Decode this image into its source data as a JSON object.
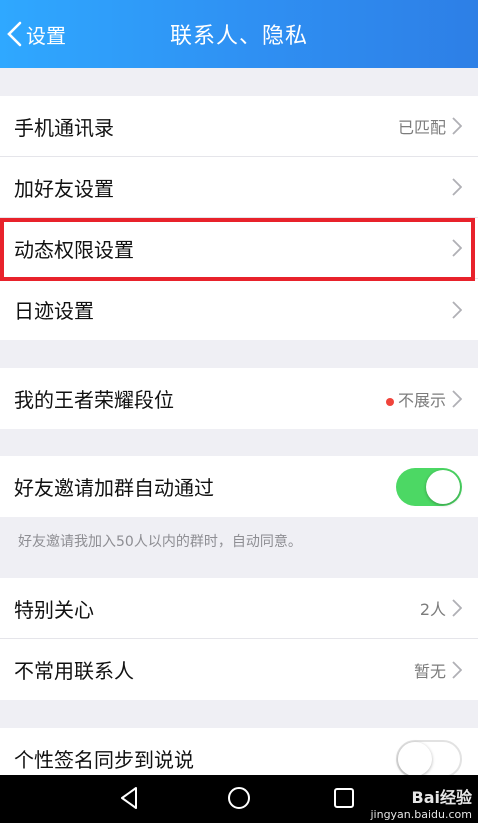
{
  "header": {
    "back_label": "设置",
    "title": "联系人、隐私"
  },
  "group1": [
    {
      "label": "手机通讯录",
      "value": "已匹配"
    },
    {
      "label": "加好友设置",
      "value": ""
    },
    {
      "label": "动态权限设置",
      "value": ""
    },
    {
      "label": "日迹设置",
      "value": ""
    }
  ],
  "group2": {
    "label": "我的王者荣耀段位",
    "value": "不展示"
  },
  "group3": {
    "label": "好友邀请加群自动通过",
    "toggle": "on",
    "hint": "好友邀请我加入50人以内的群时，自动同意。"
  },
  "group4": [
    {
      "label": "特别关心",
      "value": "2人"
    },
    {
      "label": "不常用联系人",
      "value": "暂无"
    }
  ],
  "group5": {
    "label": "个性签名同步到说说",
    "toggle": "off"
  },
  "watermark": {
    "logo": "Bai经验",
    "url": "jingyan.baidu.com"
  },
  "colors": {
    "header": "#2f8ff2",
    "toggle_on": "#4cd864",
    "highlight": "#e8222b"
  }
}
